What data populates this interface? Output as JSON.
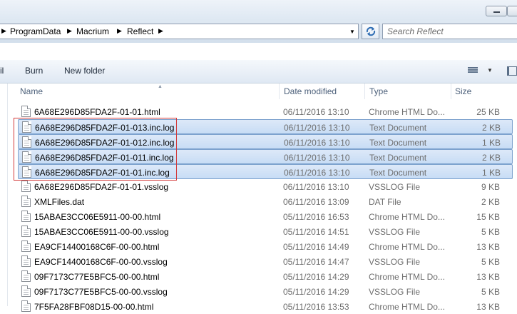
{
  "address": {
    "crumbs": [
      "ProgramData",
      "Macrium",
      "Reflect"
    ]
  },
  "search": {
    "placeholder": "Search Reflect"
  },
  "toolbar": {
    "cut_label": "il",
    "burn_label": "Burn",
    "new_folder_label": "New folder"
  },
  "columns": {
    "name": "Name",
    "date": "Date modified",
    "type": "Type",
    "size": "Size"
  },
  "files": [
    {
      "name": "6A68E296D85FDA2F-01-01.html",
      "date": "06/11/2016 13:10",
      "type": "Chrome HTML Do...",
      "size": "25 KB",
      "selected": false
    },
    {
      "name": "6A68E296D85FDA2F-01-013.inc.log",
      "date": "06/11/2016 13:10",
      "type": "Text Document",
      "size": "2 KB",
      "selected": true
    },
    {
      "name": "6A68E296D85FDA2F-01-012.inc.log",
      "date": "06/11/2016 13:10",
      "type": "Text Document",
      "size": "1 KB",
      "selected": true
    },
    {
      "name": "6A68E296D85FDA2F-01-011.inc.log",
      "date": "06/11/2016 13:10",
      "type": "Text Document",
      "size": "2 KB",
      "selected": true
    },
    {
      "name": "6A68E296D85FDA2F-01-01.inc.log",
      "date": "06/11/2016 13:10",
      "type": "Text Document",
      "size": "1 KB",
      "selected": true
    },
    {
      "name": "6A68E296D85FDA2F-01-01.vsslog",
      "date": "06/11/2016 13:10",
      "type": "VSSLOG File",
      "size": "9 KB",
      "selected": false
    },
    {
      "name": "XMLFiles.dat",
      "date": "06/11/2016 13:09",
      "type": "DAT File",
      "size": "2 KB",
      "selected": false
    },
    {
      "name": "15ABAE3CC06E5911-00-00.html",
      "date": "05/11/2016 16:53",
      "type": "Chrome HTML Do...",
      "size": "15 KB",
      "selected": false
    },
    {
      "name": "15ABAE3CC06E5911-00-00.vsslog",
      "date": "05/11/2016 14:51",
      "type": "VSSLOG File",
      "size": "5 KB",
      "selected": false
    },
    {
      "name": "EA9CF14400168C6F-00-00.html",
      "date": "05/11/2016 14:49",
      "type": "Chrome HTML Do...",
      "size": "13 KB",
      "selected": false
    },
    {
      "name": "EA9CF14400168C6F-00-00.vsslog",
      "date": "05/11/2016 14:47",
      "type": "VSSLOG File",
      "size": "5 KB",
      "selected": false
    },
    {
      "name": "09F7173C77E5BFC5-00-00.html",
      "date": "05/11/2016 14:29",
      "type": "Chrome HTML Do...",
      "size": "13 KB",
      "selected": false
    },
    {
      "name": "09F7173C77E5BFC5-00-00.vsslog",
      "date": "05/11/2016 14:29",
      "type": "VSSLOG File",
      "size": "5 KB",
      "selected": false
    },
    {
      "name": "7F5FA28FBF08D15-00-00.html",
      "date": "05/11/2016 13:53",
      "type": "Chrome HTML Do...",
      "size": "13 KB",
      "selected": false
    }
  ],
  "icons": {
    "refresh": "refresh-icon",
    "view": "view-options-icon",
    "pane": "preview-pane-icon",
    "file": "document-icon"
  }
}
